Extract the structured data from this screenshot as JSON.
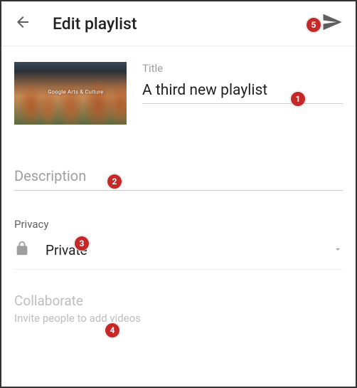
{
  "header": {
    "title": "Edit playlist"
  },
  "thumbnail": {
    "caption": "Google Arts & Culture"
  },
  "title_field": {
    "label": "Title",
    "value": "A third new playlist"
  },
  "description": {
    "placeholder": "Description"
  },
  "privacy": {
    "label": "Privacy",
    "value": "Private"
  },
  "collaborate": {
    "title": "Collaborate",
    "subtitle": "Invite people to add videos"
  },
  "annotations": {
    "a1": "1",
    "a2": "2",
    "a3": "3",
    "a4": "4",
    "a5": "5"
  }
}
